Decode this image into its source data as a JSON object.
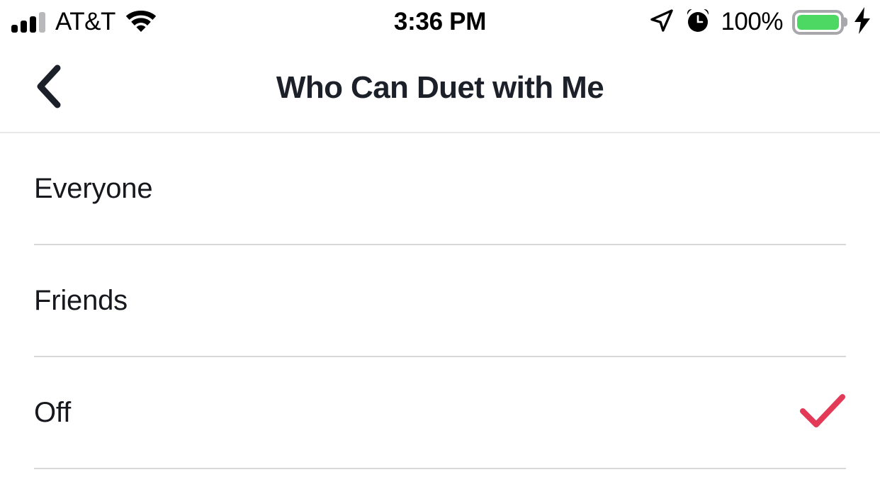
{
  "status_bar": {
    "carrier": "AT&T",
    "time": "3:36 PM",
    "battery_percent": "100%",
    "signal_icon": "signal-bars-icon",
    "wifi_icon": "wifi-icon",
    "location_icon": "location-arrow-icon",
    "alarm_icon": "alarm-clock-icon",
    "battery_icon": "battery-icon",
    "charging_icon": "lightning-bolt-icon",
    "battery_fill_color": "#4cd863",
    "battery_outline_color": "#a8a8ac"
  },
  "nav": {
    "back_icon": "chevron-left-icon",
    "title": "Who Can Duet with Me"
  },
  "list": {
    "accent_color": "#e23a57",
    "options": [
      {
        "label": "Everyone",
        "selected": false
      },
      {
        "label": "Friends",
        "selected": false
      },
      {
        "label": "Off",
        "selected": true
      }
    ]
  }
}
